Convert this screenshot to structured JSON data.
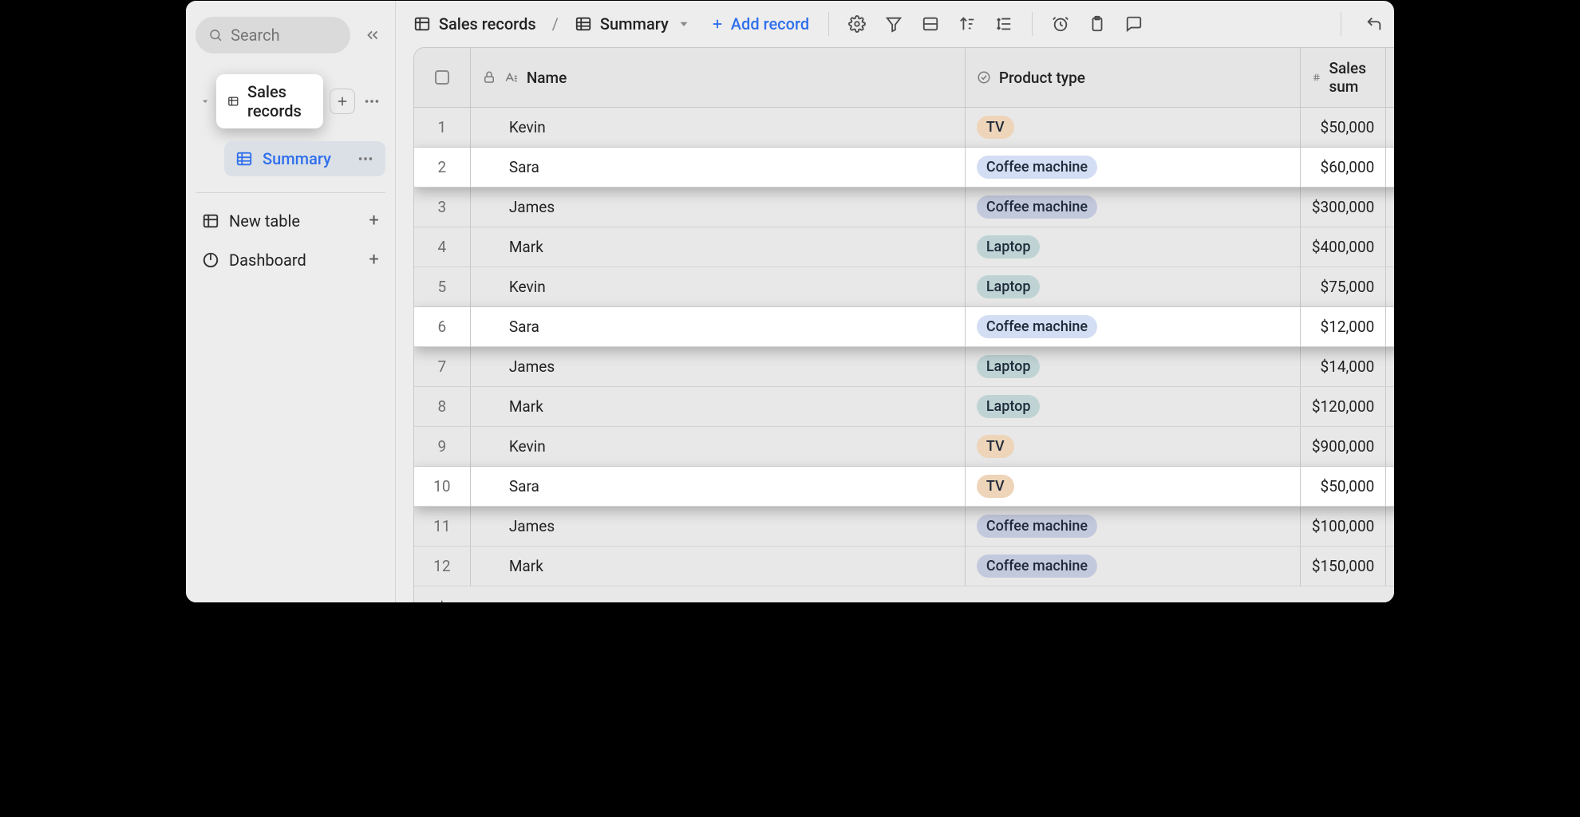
{
  "sidebar": {
    "search_placeholder": "Search",
    "tree": {
      "table_label": "Sales records",
      "view_label": "Summary"
    },
    "items": [
      {
        "label": "New table"
      },
      {
        "label": "Dashboard"
      }
    ]
  },
  "topbar": {
    "breadcrumb_table": "Sales records",
    "breadcrumb_view": "Summary",
    "add_record_label": "Add record"
  },
  "columns": {
    "name": "Name",
    "product_type": "Product type",
    "sales_sum": "Sales sum"
  },
  "rows": [
    {
      "idx": "1",
      "name": "Kevin",
      "product": "TV",
      "tag": "tv",
      "sum": "$50,000",
      "hi": false
    },
    {
      "idx": "2",
      "name": "Sara",
      "product": "Coffee machine",
      "tag": "coffee",
      "sum": "$60,000",
      "hi": true
    },
    {
      "idx": "3",
      "name": "James",
      "product": "Coffee machine",
      "tag": "coffee-m",
      "sum": "$300,000",
      "hi": false
    },
    {
      "idx": "4",
      "name": "Mark",
      "product": "Laptop",
      "tag": "laptop",
      "sum": "$400,000",
      "hi": false
    },
    {
      "idx": "5",
      "name": "Kevin",
      "product": "Laptop",
      "tag": "laptop",
      "sum": "$75,000",
      "hi": false
    },
    {
      "idx": "6",
      "name": "Sara",
      "product": "Coffee machine",
      "tag": "coffee",
      "sum": "$12,000",
      "hi": true
    },
    {
      "idx": "7",
      "name": "James",
      "product": "Laptop",
      "tag": "laptop",
      "sum": "$14,000",
      "hi": false
    },
    {
      "idx": "8",
      "name": "Mark",
      "product": "Laptop",
      "tag": "laptop",
      "sum": "$120,000",
      "hi": false
    },
    {
      "idx": "9",
      "name": "Kevin",
      "product": "TV",
      "tag": "tv",
      "sum": "$900,000",
      "hi": false
    },
    {
      "idx": "10",
      "name": "Sara",
      "product": "TV",
      "tag": "tv",
      "sum": "$50,000",
      "hi": true
    },
    {
      "idx": "11",
      "name": "James",
      "product": "Coffee machine",
      "tag": "coffee-m",
      "sum": "$100,000",
      "hi": false
    },
    {
      "idx": "12",
      "name": "Mark",
      "product": "Coffee machine",
      "tag": "coffee-m",
      "sum": "$150,000",
      "hi": false
    }
  ]
}
